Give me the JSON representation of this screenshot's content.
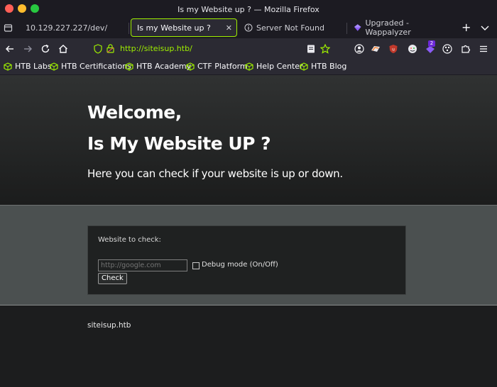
{
  "window": {
    "title": "Is my Website up ? — Mozilla Firefox"
  },
  "tabs": [
    {
      "label": "10.129.227.227/dev/"
    },
    {
      "label": "Is my Website up ?"
    },
    {
      "label": "Server Not Found"
    },
    {
      "label": "Upgraded - Wappalyzer"
    }
  ],
  "navbar": {
    "url": "http://siteisup.htb/",
    "extension_badge": "2"
  },
  "bookmarks": [
    {
      "label": "HTB Labs"
    },
    {
      "label": "HTB Certifications"
    },
    {
      "label": "HTB Academy"
    },
    {
      "label": "CTF Platform"
    },
    {
      "label": "Help Center"
    },
    {
      "label": "HTB Blog"
    }
  ],
  "hero": {
    "line1": "Welcome,",
    "line2": "Is My Website UP ?",
    "subtitle": "Here you can check if your website is up or down."
  },
  "form": {
    "label": "Website to check:",
    "placeholder": "http://google.com",
    "debug_label": "Debug mode (On/Off)",
    "button": "Check"
  },
  "footer": {
    "text": "siteisup.htb"
  },
  "colors": {
    "accent": "#9fef00",
    "chrome": "#2b2a33",
    "band": "#4b5050"
  }
}
